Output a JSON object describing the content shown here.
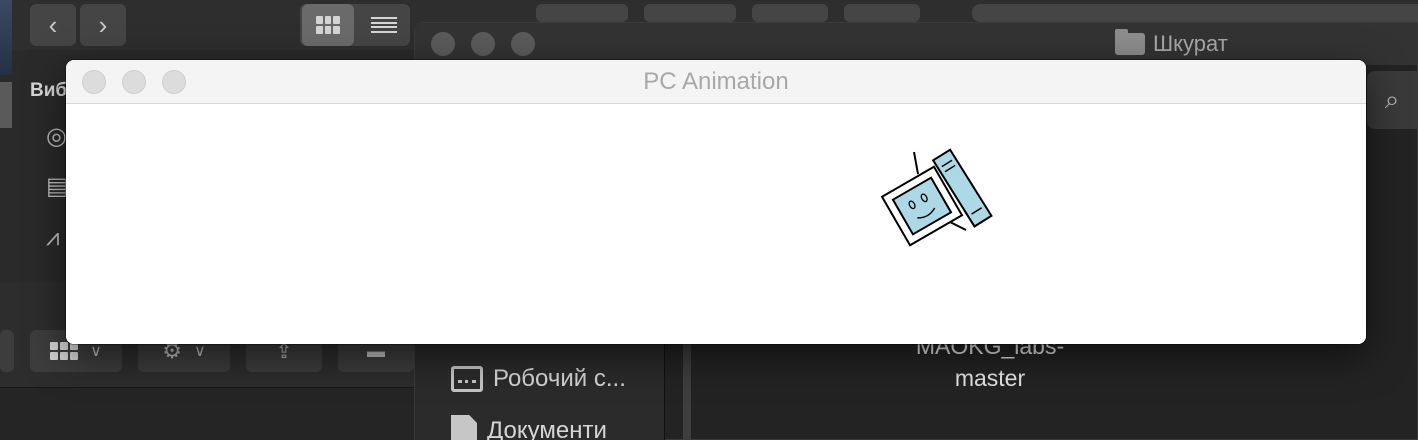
{
  "background_left": {
    "sidebar_label": "Виб",
    "toolbar": {
      "back_icon": "chevron-left-icon",
      "forward_icon": "chevron-right-icon",
      "view_grid_icon": "grid-icon",
      "view_list_icon": "list-icon"
    }
  },
  "finder": {
    "title": "Шкурат",
    "sidebar_items": [
      {
        "label": "Робочий с...",
        "icon": "desktop-icon"
      },
      {
        "label": "Документи",
        "icon": "document-icon"
      }
    ],
    "file": {
      "label_line1": "MAOKG_labs-",
      "label_line2": "master"
    }
  },
  "app": {
    "title": "PC Animation",
    "canvas_figure": "computer-icon",
    "colors": {
      "screen_fill": "#add8e6",
      "outline": "#000000"
    }
  }
}
